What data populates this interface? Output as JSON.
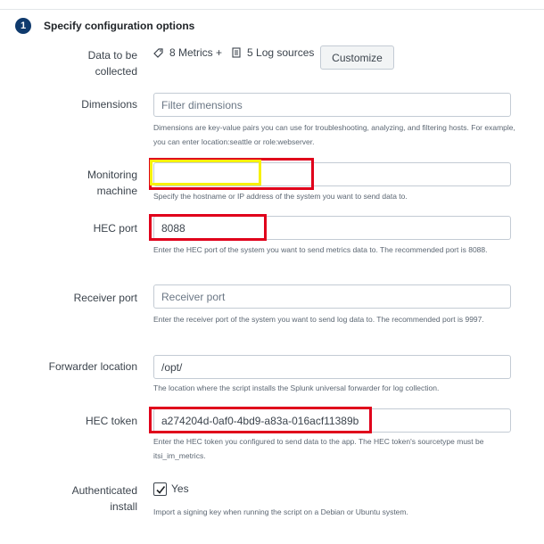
{
  "step": {
    "number": "1",
    "title": "Specify configuration options"
  },
  "data_collected": {
    "label": "Data to be collected",
    "metrics": "8 Metrics +",
    "logs": "5 Log sources",
    "customize_label": "Customize"
  },
  "dimensions": {
    "label": "Dimensions",
    "placeholder": "Filter dimensions",
    "help": "Dimensions are key-value pairs you can use for troubleshooting, analyzing, and filtering hosts. For example, you can enter location:seattle or role:webserver."
  },
  "monitoring_machine": {
    "label": "Monitoring machine",
    "value": "",
    "help": "Specify the hostname or IP address of the system you want to send data to."
  },
  "hec_port": {
    "label": "HEC port",
    "value": "8088",
    "help": "Enter the HEC port of the system you want to send metrics data to. The recommended port is 8088."
  },
  "receiver_port": {
    "label": "Receiver port",
    "placeholder": "Receiver port",
    "help": "Enter the receiver port of the system you want to send log data to. The recommended port is 9997."
  },
  "forwarder_location": {
    "label": "Forwarder location",
    "value": "/opt/",
    "help": "The location where the script installs the Splunk universal forwarder for log collection."
  },
  "hec_token": {
    "label": "HEC token",
    "value": "a274204d-0af0-4bd9-a83a-016acf11389b",
    "help": "Enter the HEC token you configured to send data to the app. The HEC token's sourcetype must be itsi_im_metrics."
  },
  "authenticated_install": {
    "label": "Authenticated install",
    "checked": true,
    "yes_label": "Yes",
    "help": "Import a signing key when running the script on a Debian or Ubuntu system."
  },
  "colors": {
    "badge": "#0f3a6d",
    "highlight_red": "#e0001b",
    "highlight_yellow": "#f7f10a"
  }
}
